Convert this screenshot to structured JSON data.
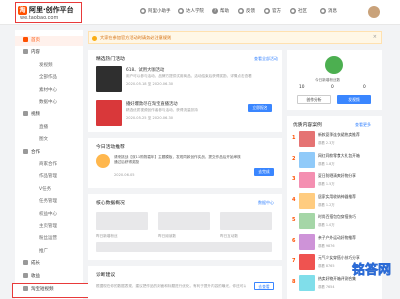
{
  "topbar": {
    "logo_mark": "淘",
    "logo_title": "阿里·创作平台",
    "logo_url": "we.taobao.com",
    "nav": [
      "阿里小助手",
      "达人学院",
      "帮助",
      "反馈",
      "官方",
      "社区",
      "消息"
    ]
  },
  "sidebar": {
    "items": [
      {
        "label": "首页",
        "type": "sec",
        "active": true
      },
      {
        "label": "内容",
        "type": "sec"
      },
      {
        "label": "发视频",
        "type": "sub"
      },
      {
        "label": "全部作品",
        "type": "sub"
      },
      {
        "label": "素材中心",
        "type": "sub"
      },
      {
        "label": "数据中心",
        "type": "sub"
      },
      {
        "label": "视频",
        "type": "sec"
      },
      {
        "label": "直播",
        "type": "sub"
      },
      {
        "label": "图文",
        "type": "sub"
      },
      {
        "label": "合作",
        "type": "sec"
      },
      {
        "label": "商家合作",
        "type": "sub"
      },
      {
        "label": "作品管理",
        "type": "sub"
      },
      {
        "label": "V任务",
        "type": "sub"
      },
      {
        "label": "任务管理",
        "type": "sub"
      },
      {
        "label": "权益中心",
        "type": "sub"
      },
      {
        "label": "主页管理",
        "type": "sub"
      },
      {
        "label": "粉丝运营",
        "type": "sub"
      },
      {
        "label": "推广",
        "type": "sub"
      },
      {
        "label": "成长",
        "type": "sec"
      },
      {
        "label": "收益",
        "type": "sec"
      },
      {
        "label": "账号",
        "type": "sec"
      }
    ],
    "bottom_item": "淘宝短视频"
  },
  "notice": {
    "text": "大家在参加官方活动时请务必注意规则",
    "close": "×"
  },
  "hot_activity": {
    "title": "精选热门活动",
    "more": "查看全部活动",
    "items": [
      {
        "title": "618、试用大咖活动",
        "desc": "用户可以参与活动，品牌方提供试用商品，活动结束后获得奖励，详情点击查看",
        "meta": "2020.05.18 至 2020.06.30",
        "button": "立即报名"
      },
      {
        "title": "播好爆款尽在淘宝直播活动",
        "desc": "精选优质视频创作者参与活动，获得流量扶持",
        "meta": "2020.05.25 至 2020.06.30",
        "button": "立即报名"
      }
    ]
  },
  "today_todo": {
    "title": "今日活动推荐",
    "text": "请来挑战【双11购物嘉年】主题模板，发现同款创作实战，提交作品后开始审核通过后获得奖励",
    "meta": "2020.06.05",
    "button": "去完成"
  },
  "core_data": {
    "title": "核心数据概况",
    "more": "数据中心",
    "labels": [
      "昨日新增粉丝",
      "昨日阅读数",
      "昨日互动数"
    ]
  },
  "analysis": {
    "title": "诊断建议",
    "text": "根据现在你的数据表现，建议把作品的封面和标题进行优化，有利于提升内容的曝光，你还可以参考优质创作案例",
    "button": "去查看"
  },
  "profile": {
    "name": "今日新增粉丝数",
    "stats": [
      "10",
      "0",
      "0"
    ],
    "stat_labels": [
      "粉丝",
      "作品",
      "获赞"
    ],
    "btn_secondary": "创作分析",
    "btn_primary": "发视频"
  },
  "ranking": {
    "title": "优质内容案例",
    "more": "查看更多",
    "items": [
      {
        "rank": "1",
        "title": "新款夏季连衣裙热卖推荐",
        "sub": "观看 2.3万"
      },
      {
        "rank": "2",
        "title": "网红同款零食大礼包开箱",
        "sub": "观看 1.8万"
      },
      {
        "rank": "3",
        "title": "夏日防晒清爽好物分享",
        "sub": "观看 1.5万"
      },
      {
        "rank": "4",
        "title": "居家实用收纳神器推荐",
        "sub": "观看 1.2万"
      },
      {
        "rank": "5",
        "title": "时尚百搭包包穿搭技巧",
        "sub": "观看 1.0万"
      },
      {
        "rank": "6",
        "title": "亲子户外运动好物推荐",
        "sub": "观看 9876"
      },
      {
        "rank": "7",
        "title": "元气少女穿搭小技巧分享",
        "sub": "观看 8765"
      },
      {
        "rank": "8",
        "title": "热卖好物开箱评测合集",
        "sub": "观看 7654"
      }
    ]
  },
  "watermark": "铭答网",
  "colors": {
    "accent": "#ff5000",
    "primary": "#3a86ff",
    "notice_bg": "#fff7e6"
  }
}
